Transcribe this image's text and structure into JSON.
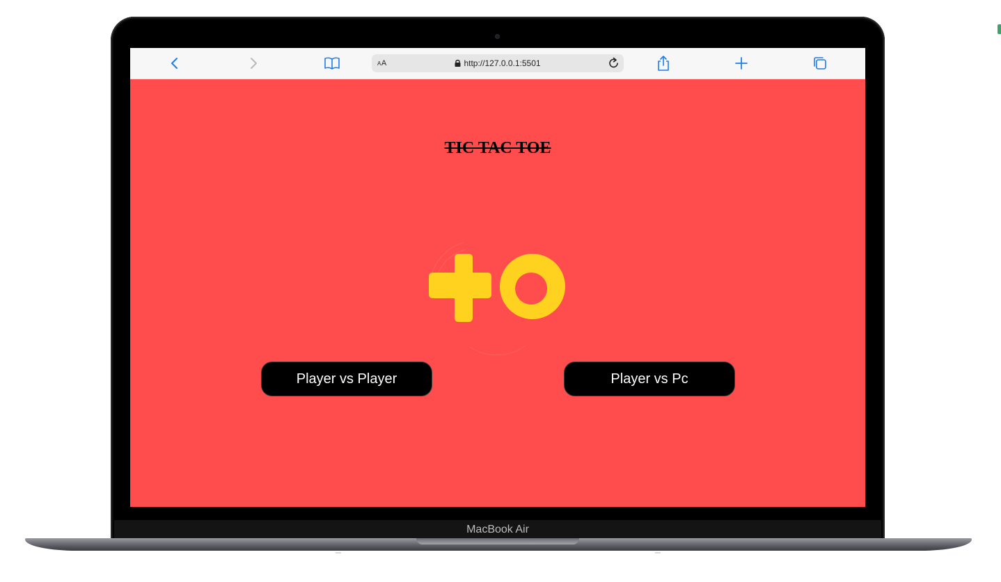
{
  "browser": {
    "url_prefix_label": "AA",
    "url": "http://127.0.0.1:5501",
    "icons": [
      "back-icon",
      "forward-icon",
      "bookmarks-icon",
      "lock-icon",
      "reload-icon",
      "share-icon",
      "new-tab-icon",
      "tabs-icon"
    ]
  },
  "page": {
    "title": "TIC TAC TOE",
    "logo": "plus-and-ring-logo",
    "buttons": {
      "pvp": "Player vs Player",
      "pvc": "Player vs Pc"
    }
  },
  "device": {
    "label": "MacBook Air"
  },
  "colors": {
    "page_background": "#ff4d4d",
    "logo": "#ffd21f",
    "button": "#000000",
    "button_text": "#ffffff",
    "toolbar_icons": "#1a7cf2"
  }
}
